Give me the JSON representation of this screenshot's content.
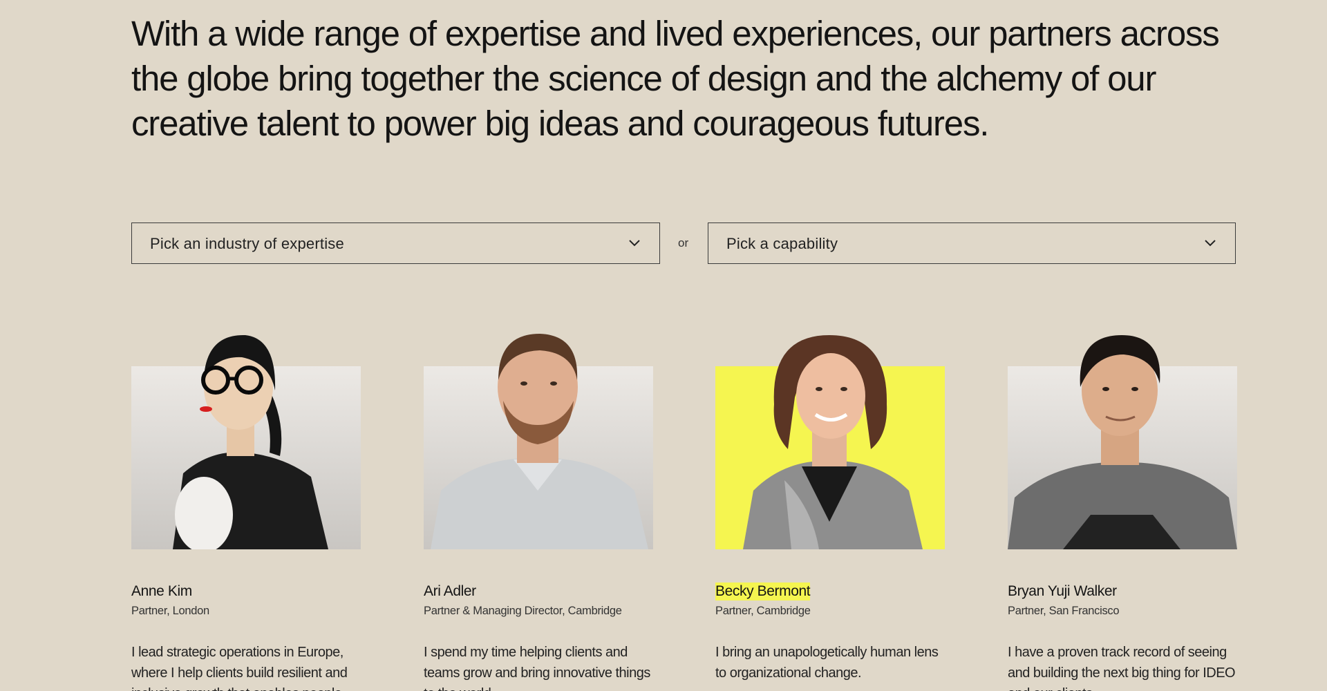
{
  "headline": "With a wide range of expertise and lived experiences, our partners across the globe bring together the science of design and the alchemy of our creative talent to power big ideas and courageous futures.",
  "filters": {
    "industry_placeholder": "Pick an industry of expertise",
    "separator": "or",
    "capability_placeholder": "Pick a capability",
    "chevron_icon": "chevron-down-icon"
  },
  "colors": {
    "background": "#e0d8c9",
    "highlight": "#f5f550",
    "text": "#141414"
  },
  "partners": [
    {
      "name": "Anne Kim",
      "role": "Partner, London",
      "bio": "I lead strategic operations in Europe, where I help clients build resilient and inclusive growth that enables people"
    },
    {
      "name": "Ari Adler",
      "role": "Partner & Managing Director, Cambridge",
      "bio": "I spend my time helping clients and teams grow and bring innovative things to the world."
    },
    {
      "name": "Becky Bermont",
      "role": "Partner, Cambridge",
      "bio": "I bring an unapologetically human lens to organizational change."
    },
    {
      "name": "Bryan Yuji Walker",
      "role": "Partner, San Francisco",
      "bio": "I have a proven track record of seeing and building the next big thing for IDEO and our clients."
    }
  ]
}
